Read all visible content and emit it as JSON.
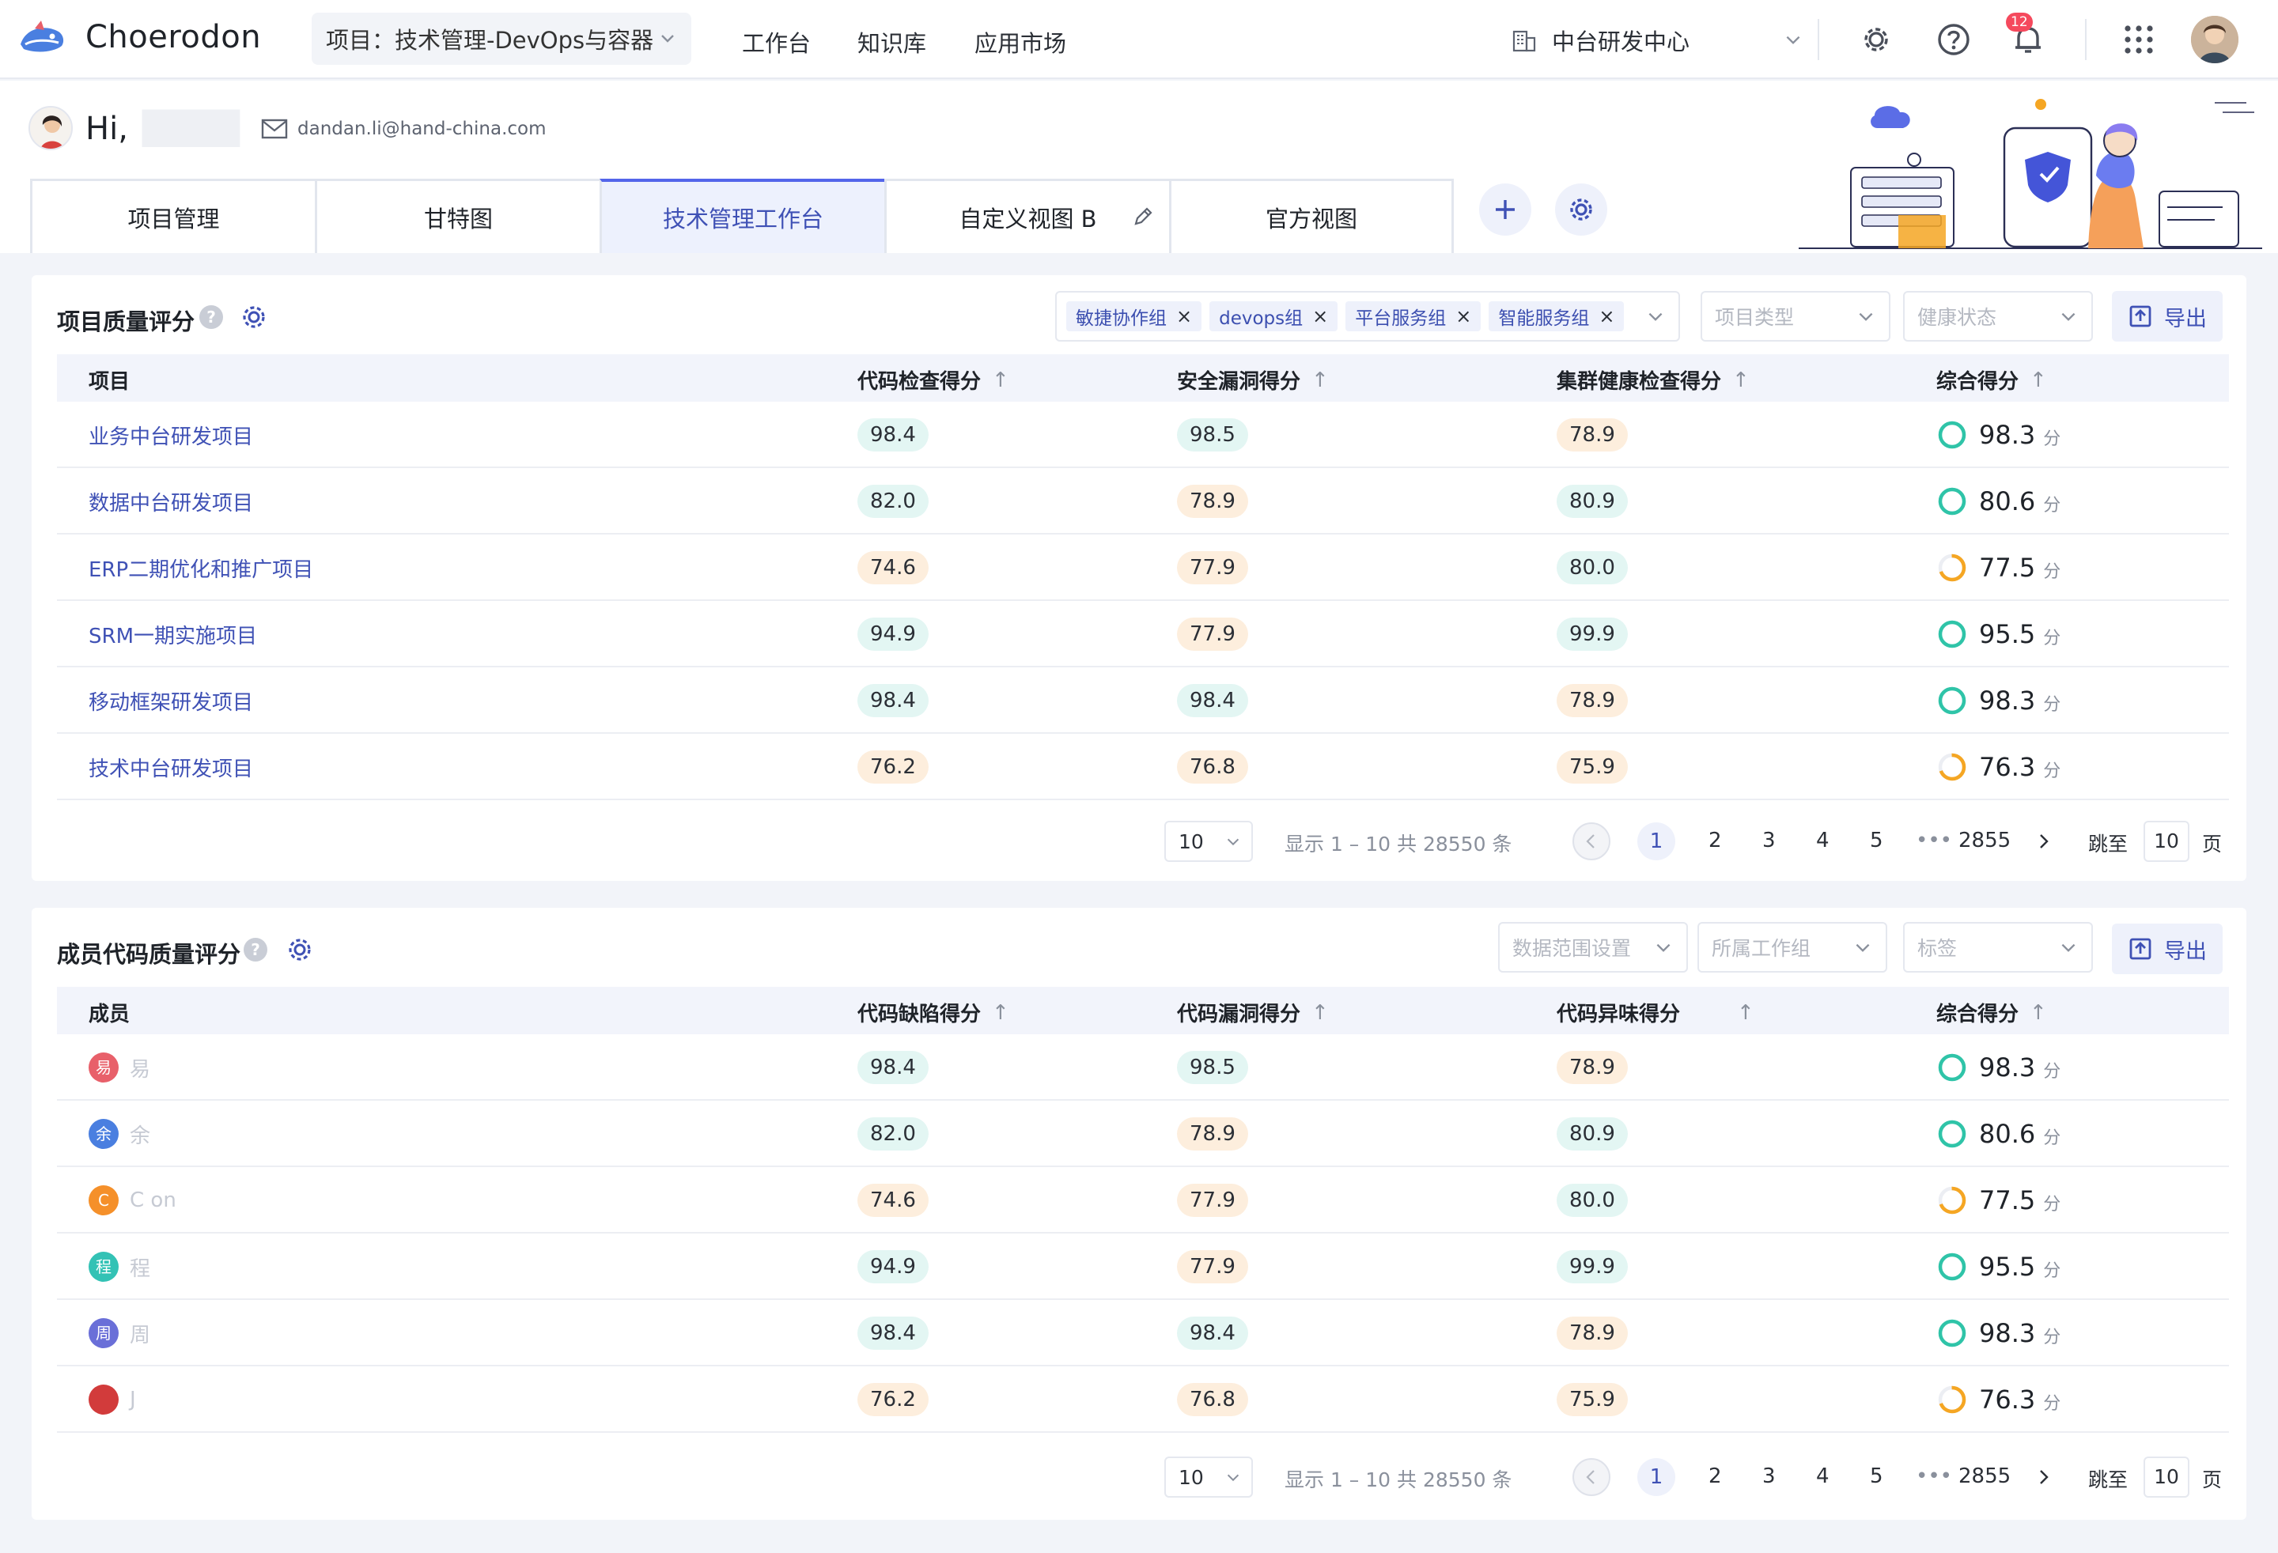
{
  "app": {
    "brand": "Choerodon"
  },
  "topnav": {
    "project_select": "项目：技术管理-DevOps与容器",
    "items": [
      "工作台",
      "知识库",
      "应用市场"
    ],
    "org": "中台研发中心",
    "notification_count": "12"
  },
  "header": {
    "greeting": "Hi,",
    "email": "dandan.li@hand-china.com",
    "tabs": [
      "项目管理",
      "甘特图",
      "技术管理工作台",
      "自定义视图 B",
      "官方视图"
    ],
    "active_tab": "技术管理工作台"
  },
  "project_quality": {
    "title": "项目质量评分",
    "filters": {
      "tags": [
        "敏捷协作组",
        "devops组",
        "平台服务组",
        "智能服务组"
      ],
      "project_type_placeholder": "项目类型",
      "health_placeholder": "健康状态"
    },
    "export_label": "导出",
    "columns": [
      "项目",
      "代码检查得分",
      "安全漏洞得分",
      "集群健康检查得分",
      "综合得分"
    ],
    "unit": "分",
    "rows": [
      {
        "name": "业务中台研发项目",
        "s1": "98.4",
        "s1c": "good",
        "s2": "98.5",
        "s2c": "good",
        "s3": "78.9",
        "s3c": "warn",
        "total": "98.3",
        "ring": "good"
      },
      {
        "name": "数据中台研发项目",
        "s1": "82.0",
        "s1c": "good",
        "s2": "78.9",
        "s2c": "warn",
        "s3": "80.9",
        "s3c": "good",
        "total": "80.6",
        "ring": "good"
      },
      {
        "name": "ERP二期优化和推广项目",
        "s1": "74.6",
        "s1c": "warn",
        "s2": "77.9",
        "s2c": "warn",
        "s3": "80.0",
        "s3c": "good",
        "total": "77.5",
        "ring": "warn"
      },
      {
        "name": "SRM一期实施项目",
        "s1": "94.9",
        "s1c": "good",
        "s2": "77.9",
        "s2c": "warn",
        "s3": "99.9",
        "s3c": "good",
        "total": "95.5",
        "ring": "good"
      },
      {
        "name": "移动框架研发项目",
        "s1": "98.4",
        "s1c": "good",
        "s2": "98.4",
        "s2c": "good",
        "s3": "78.9",
        "s3c": "warn",
        "total": "98.3",
        "ring": "good"
      },
      {
        "name": "技术中台研发项目",
        "s1": "76.2",
        "s1c": "warn",
        "s2": "76.8",
        "s2c": "warn",
        "s3": "75.9",
        "s3c": "warn",
        "total": "76.3",
        "ring": "warn"
      }
    ],
    "pager": {
      "size": "10",
      "info": "显示 1 – 10 共 28550 条",
      "pages": [
        "1",
        "2",
        "3",
        "4",
        "5",
        "•••",
        "2855"
      ],
      "jump_label": "跳至",
      "jump_value": "10",
      "page_unit": "页"
    }
  },
  "member_quality": {
    "title": "成员代码质量评分",
    "filters": {
      "range_placeholder": "数据范围设置",
      "group_placeholder": "所属工作组",
      "label_placeholder": "标签"
    },
    "export_label": "导出",
    "columns": [
      "成员",
      "代码缺陷得分",
      "代码漏洞得分",
      "代码异味得分",
      "综合得分"
    ],
    "unit": "分",
    "rows": [
      {
        "avatar": "易",
        "color": "#e8606a",
        "name": "易",
        "s1": "98.4",
        "s1c": "good",
        "s2": "98.5",
        "s2c": "good",
        "s3": "78.9",
        "s3c": "warn",
        "total": "98.3",
        "ring": "good"
      },
      {
        "avatar": "余",
        "color": "#4a7fe0",
        "name": "余",
        "s1": "82.0",
        "s1c": "good",
        "s2": "78.9",
        "s2c": "warn",
        "s3": "80.9",
        "s3c": "good",
        "total": "80.6",
        "ring": "good"
      },
      {
        "avatar": "C",
        "color": "#f5902a",
        "name": "C on",
        "s1": "74.6",
        "s1c": "warn",
        "s2": "77.9",
        "s2c": "warn",
        "s3": "80.0",
        "s3c": "good",
        "total": "77.5",
        "ring": "warn"
      },
      {
        "avatar": "程",
        "color": "#33c2b5",
        "name": "程",
        "s1": "94.9",
        "s1c": "good",
        "s2": "77.9",
        "s2c": "warn",
        "s3": "99.9",
        "s3c": "good",
        "total": "95.5",
        "ring": "good"
      },
      {
        "avatar": "周",
        "color": "#6a6fd8",
        "name": "周",
        "s1": "98.4",
        "s1c": "good",
        "s2": "98.4",
        "s2c": "good",
        "s3": "78.9",
        "s3c": "warn",
        "total": "98.3",
        "ring": "good"
      },
      {
        "avatar": "",
        "color": "#d23b3b",
        "name": "J",
        "s1": "76.2",
        "s1c": "warn",
        "s2": "76.8",
        "s2c": "warn",
        "s3": "75.9",
        "s3c": "warn",
        "total": "76.3",
        "ring": "warn"
      }
    ],
    "pager": {
      "size": "10",
      "info": "显示 1 – 10 共 28550 条",
      "pages": [
        "1",
        "2",
        "3",
        "4",
        "5",
        "•••",
        "2855"
      ],
      "jump_label": "跳至",
      "jump_value": "10",
      "page_unit": "页"
    }
  },
  "colors": {
    "accent": "#3f51b5",
    "good_ring": "#2fc4a8",
    "warn_ring": "#f5a623"
  }
}
